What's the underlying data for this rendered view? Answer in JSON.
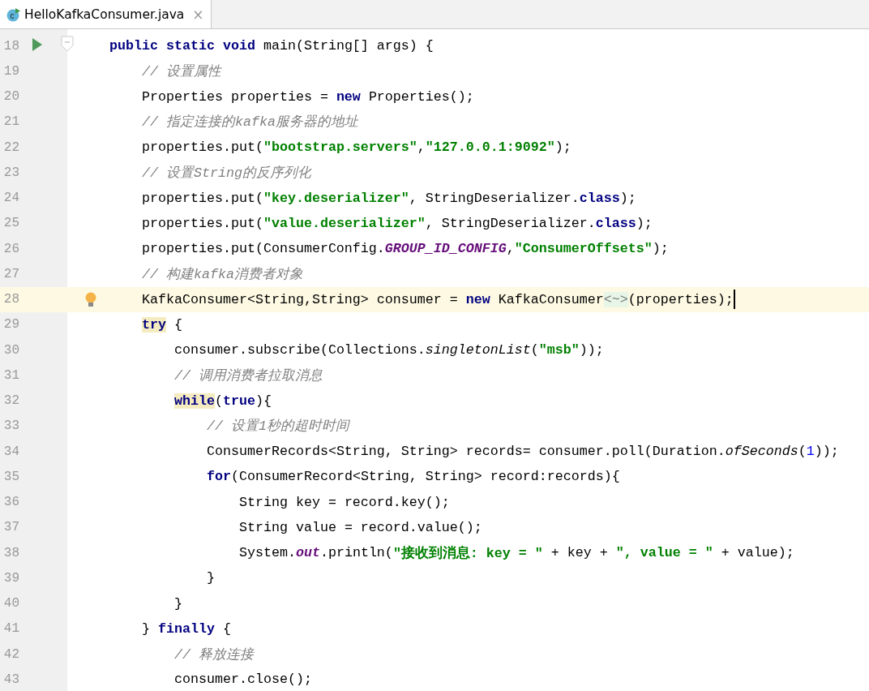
{
  "tabs": [
    {
      "icon_text": "c",
      "title": "HelloKafkaConsumer.java",
      "close": "×",
      "selected": true
    }
  ],
  "lines": [
    {
      "number": "18",
      "kind": "run",
      "foldable": true,
      "current": false,
      "tokens": [
        {
          "text": "public static void",
          "kind": "keyword"
        },
        {
          "text": " main(String[] args) {",
          "kind": "plain"
        }
      ]
    },
    {
      "number": "19",
      "current": false,
      "tokens": [
        {
          "text": "    // 设置属性",
          "kind": "comment"
        }
      ]
    },
    {
      "number": "20",
      "current": false,
      "tokens": [
        {
          "text": "    Properties properties = ",
          "kind": "plain"
        },
        {
          "text": "new",
          "kind": "keyword"
        },
        {
          "text": " Properties();",
          "kind": "plain"
        }
      ]
    },
    {
      "number": "21",
      "current": false,
      "tokens": [
        {
          "text": "    // 指定连接的kafka服务器的地址",
          "kind": "comment"
        }
      ]
    },
    {
      "number": "22",
      "current": false,
      "tokens": [
        {
          "text": "    properties.put(",
          "kind": "plain"
        },
        {
          "text": "\"bootstrap.servers\"",
          "kind": "string"
        },
        {
          "text": ",",
          "kind": "plain"
        },
        {
          "text": "\"127.0.0.1:9092\"",
          "kind": "string"
        },
        {
          "text": ");",
          "kind": "plain"
        }
      ]
    },
    {
      "number": "23",
      "current": false,
      "tokens": [
        {
          "text": "    // 设置String的反序列化",
          "kind": "comment"
        }
      ]
    },
    {
      "number": "24",
      "current": false,
      "tokens": [
        {
          "text": "    properties.put(",
          "kind": "plain"
        },
        {
          "text": "\"key.deserializer\"",
          "kind": "string"
        },
        {
          "text": ", StringDeserializer.",
          "kind": "plain"
        },
        {
          "text": "class",
          "kind": "keyword"
        },
        {
          "text": ");",
          "kind": "plain"
        }
      ]
    },
    {
      "number": "25",
      "current": false,
      "tokens": [
        {
          "text": "    properties.put(",
          "kind": "plain"
        },
        {
          "text": "\"value.deserializer\"",
          "kind": "string"
        },
        {
          "text": ", StringDeserializer.",
          "kind": "plain"
        },
        {
          "text": "class",
          "kind": "keyword"
        },
        {
          "text": ");",
          "kind": "plain"
        }
      ]
    },
    {
      "number": "26",
      "current": false,
      "tokens": [
        {
          "text": "    properties.put(ConsumerConfig.",
          "kind": "plain"
        },
        {
          "text": "GROUP_ID_CONFIG",
          "kind": "constant"
        },
        {
          "text": ",",
          "kind": "plain"
        },
        {
          "text": "\"ConsumerOffsets\"",
          "kind": "string"
        },
        {
          "text": ");",
          "kind": "plain"
        }
      ]
    },
    {
      "number": "27",
      "current": false,
      "tokens": [
        {
          "text": "    // 构建kafka消费者对象",
          "kind": "comment"
        }
      ]
    },
    {
      "number": "28",
      "kind": "bulb",
      "current": true,
      "caret": true,
      "tokens": [
        {
          "text": "    KafkaConsumer<String,String> consumer = ",
          "kind": "plain"
        },
        {
          "text": "new",
          "kind": "keyword"
        },
        {
          "text": " KafkaConsumer",
          "kind": "plain"
        },
        {
          "text": "<~>",
          "kind": "hint"
        },
        {
          "text": "(properties);",
          "kind": "plain"
        }
      ]
    },
    {
      "number": "29",
      "current": false,
      "tokens": [
        {
          "text": "    try",
          "kind": "keyword",
          "highlighted": true
        },
        {
          "text": " {",
          "kind": "plain"
        }
      ]
    },
    {
      "number": "30",
      "current": false,
      "tokens": [
        {
          "text": "        consumer.subscribe(Collections.",
          "kind": "plain"
        },
        {
          "text": "singletonList",
          "kind": "italic"
        },
        {
          "text": "(",
          "kind": "plain"
        },
        {
          "text": "\"msb\"",
          "kind": "string"
        },
        {
          "text": "));",
          "kind": "plain"
        }
      ]
    },
    {
      "number": "31",
      "current": false,
      "tokens": [
        {
          "text": "        // 调用消费者拉取消息",
          "kind": "comment"
        }
      ]
    },
    {
      "number": "32",
      "current": false,
      "tokens": [
        {
          "text": "        while",
          "kind": "keyword",
          "highlighted": true
        },
        {
          "text": "(",
          "kind": "plain"
        },
        {
          "text": "true",
          "kind": "keyword"
        },
        {
          "text": "){",
          "kind": "plain"
        }
      ]
    },
    {
      "number": "33",
      "current": false,
      "tokens": [
        {
          "text": "            // 设置1秒的超时时间",
          "kind": "comment"
        }
      ]
    },
    {
      "number": "34",
      "current": false,
      "tokens": [
        {
          "text": "            ConsumerRecords<String, String> records= consumer.poll(Duration.",
          "kind": "plain"
        },
        {
          "text": "ofSeconds",
          "kind": "italic"
        },
        {
          "text": "(",
          "kind": "plain"
        },
        {
          "text": "1",
          "kind": "number"
        },
        {
          "text": "));",
          "kind": "plain"
        }
      ]
    },
    {
      "number": "35",
      "current": false,
      "tokens": [
        {
          "text": "            for",
          "kind": "keyword"
        },
        {
          "text": "(ConsumerRecord<String, String> record:records){",
          "kind": "plain"
        }
      ]
    },
    {
      "number": "36",
      "current": false,
      "tokens": [
        {
          "text": "                String key = record.key();",
          "kind": "plain"
        }
      ]
    },
    {
      "number": "37",
      "current": false,
      "tokens": [
        {
          "text": "                String value = record.value();",
          "kind": "plain"
        }
      ]
    },
    {
      "number": "38",
      "current": false,
      "tokens": [
        {
          "text": "                System.",
          "kind": "plain"
        },
        {
          "text": "out",
          "kind": "constant"
        },
        {
          "text": ".println(",
          "kind": "plain"
        },
        {
          "text": "\"接收到消息: key = \"",
          "kind": "string"
        },
        {
          "text": " + key + ",
          "kind": "plain"
        },
        {
          "text": "\", value = \"",
          "kind": "string"
        },
        {
          "text": " + value);",
          "kind": "plain"
        }
      ]
    },
    {
      "number": "39",
      "current": false,
      "tokens": [
        {
          "text": "            }",
          "kind": "plain"
        }
      ]
    },
    {
      "number": "40",
      "current": false,
      "tokens": [
        {
          "text": "        }",
          "kind": "plain"
        }
      ]
    },
    {
      "number": "41",
      "current": false,
      "tokens": [
        {
          "text": "    } ",
          "kind": "plain"
        },
        {
          "text": "finally",
          "kind": "keyword"
        },
        {
          "text": " {",
          "kind": "plain"
        }
      ]
    },
    {
      "number": "42",
      "current": false,
      "tokens": [
        {
          "text": "        // 释放连接",
          "kind": "comment"
        }
      ]
    },
    {
      "number": "43",
      "current": false,
      "tokens": [
        {
          "text": "        consumer.close();",
          "kind": "plain"
        }
      ]
    }
  ]
}
